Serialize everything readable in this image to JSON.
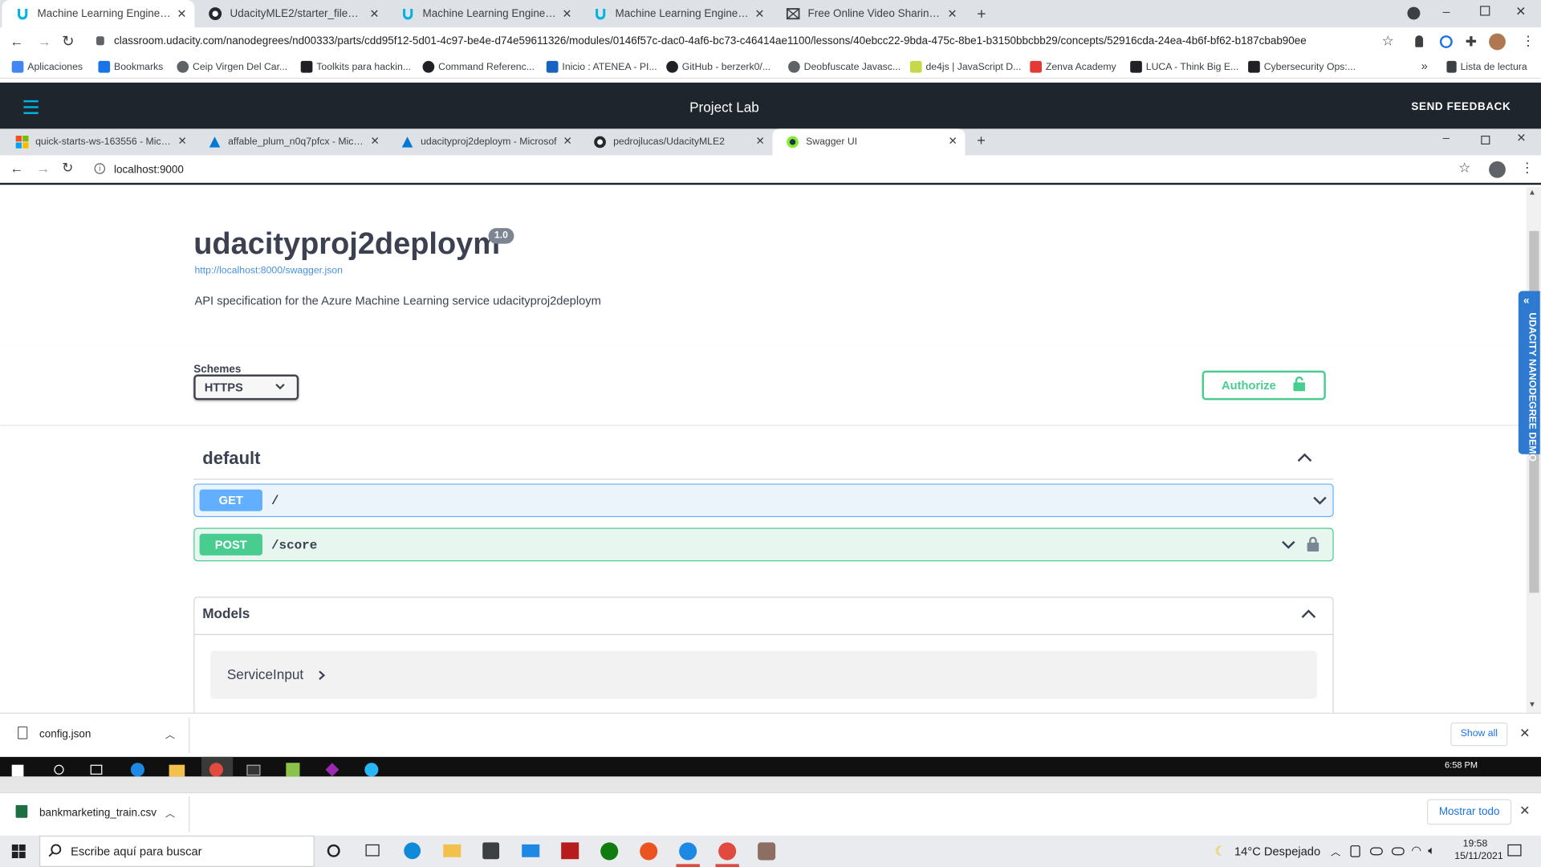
{
  "outer_browser": {
    "tabs": [
      {
        "title": "Machine Learning Engineer with",
        "icon": "udacity-icon",
        "active": true
      },
      {
        "title": "UdacityMLE2/starter_files at mas",
        "icon": "github-icon",
        "active": false
      },
      {
        "title": "Machine Learning Engineer with",
        "icon": "udacity-icon",
        "active": false
      },
      {
        "title": "Machine Learning Engineer with",
        "icon": "udacity-icon",
        "active": false
      },
      {
        "title": "Free Online Video Sharing With S",
        "icon": "streamable-icon",
        "active": false
      }
    ],
    "url": "classroom.udacity.com/nanodegrees/nd00333/parts/cdd95f12-5d01-4c97-be4e-d74e59611326/modules/0146f57c-dac0-4af6-bc73-c46414ae1100/lessons/40ebcc22-9bda-475c-8be1-b3150bbcbb29/concepts/52916cda-24ea-4b6f-bf62-b187cbab90ee",
    "bookmarks": [
      {
        "label": "Aplicaciones",
        "color": "#4285f4"
      },
      {
        "label": "Bookmarks",
        "color": "#1a73e8"
      },
      {
        "label": "Ceip Virgen Del Car...",
        "color": "#5f6368"
      },
      {
        "label": "Toolkits para hackin...",
        "color": "#202124"
      },
      {
        "label": "Command Referenc...",
        "color": "#202124"
      },
      {
        "label": "Inicio : ATENEA - PI...",
        "color": "#1565c0"
      },
      {
        "label": "GitHub - berzerk0/...",
        "color": "#202124"
      },
      {
        "label": "Deobfuscate Javasc...",
        "color": "#5f6368"
      },
      {
        "label": "de4js | JavaScript D...",
        "color": "#c6d84a"
      },
      {
        "label": "Zenva Academy",
        "color": "#e53935"
      },
      {
        "label": "LUCA - Think Big E...",
        "color": "#202124"
      },
      {
        "label": "Cybersecurity Ops:...",
        "color": "#202124"
      }
    ],
    "reading_list": "Lista de lectura"
  },
  "project_lab": {
    "title": "Project Lab",
    "feedback": "SEND FEEDBACK"
  },
  "inner_browser": {
    "tabs": [
      {
        "title": "quick-starts-ws-163556 - Micros",
        "icon": "microsoft-icon",
        "active": false
      },
      {
        "title": "affable_plum_n0q7pfcx - Microso",
        "icon": "azure-ml-icon",
        "active": false
      },
      {
        "title": "udacityproj2deploym - Microsof",
        "icon": "azure-ml-icon",
        "active": false
      },
      {
        "title": "pedrojlucas/UdacityMLE2",
        "icon": "github-icon",
        "active": false
      },
      {
        "title": "Swagger UI",
        "icon": "swagger-icon",
        "active": true
      }
    ],
    "url": "localhost:9000"
  },
  "swagger": {
    "title": "udacityproj2deploym",
    "version": "1.0",
    "spec_url": "http://localhost:8000/swagger.json",
    "description": "API specification for the Azure Machine Learning service udacityproj2deploym",
    "schemes_label": "Schemes",
    "scheme_selected": "HTTPS",
    "authorize_label": "Authorize",
    "section_title": "default",
    "operations": [
      {
        "method": "GET",
        "path": "/",
        "color": "#61affe"
      },
      {
        "method": "POST",
        "path": "/score",
        "color": "#49cc90"
      }
    ],
    "models_title": "Models",
    "models": [
      "ServiceInput"
    ]
  },
  "udacity_side_tab": "UDACITY NANODEGREE DEMO",
  "inner_download": {
    "file": "config.json",
    "show_all": "Show all"
  },
  "inner_taskbar": {
    "time": "6:58 PM"
  },
  "outer_download": {
    "file": "bankmarketing_train.csv",
    "show_all": "Mostrar todo"
  },
  "outer_taskbar": {
    "search_placeholder": "Escribe aquí para buscar",
    "weather": "14°C  Despejado",
    "time": "19:58",
    "date": "15/11/2021"
  }
}
